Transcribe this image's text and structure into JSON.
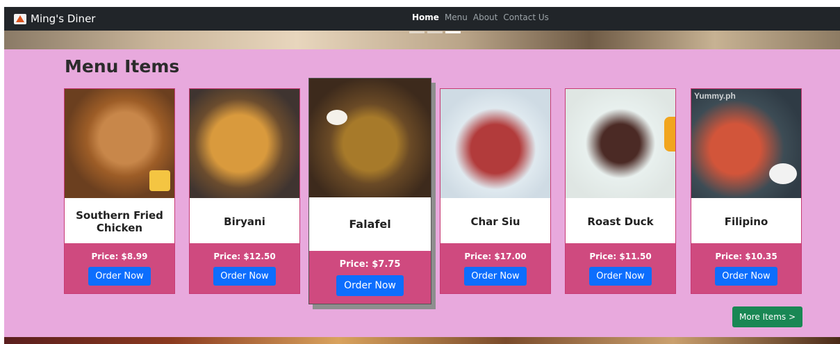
{
  "navbar": {
    "brand": "Ming's Diner",
    "links": [
      {
        "label": "Home",
        "active": true
      },
      {
        "label": "Menu",
        "active": false
      },
      {
        "label": "About",
        "active": false
      },
      {
        "label": "Contact Us",
        "active": false
      }
    ]
  },
  "carousel": {
    "slides": 3,
    "active_slide": 3
  },
  "menu": {
    "title": "Menu Items",
    "items": [
      {
        "name": "Southern Fried Chicken",
        "price": "Price: $8.99",
        "button": "Order Now"
      },
      {
        "name": "Biryani",
        "price": "Price: $12.50",
        "button": "Order Now"
      },
      {
        "name": "Falafel",
        "price": "Price: $7.75",
        "button": "Order Now"
      },
      {
        "name": "Char Siu",
        "price": "Price: $17.00",
        "button": "Order Now"
      },
      {
        "name": "Roast Duck",
        "price": "Price: $11.50",
        "button": "Order Now"
      },
      {
        "name": "Filipino",
        "price": "Price: $10.35",
        "button": "Order Now",
        "image_watermark": "Yummy.ph"
      }
    ],
    "more_button": "More Items >"
  },
  "colors": {
    "navbar": "#212529",
    "section_bg": "#e8a9dd",
    "card_footer": "#cf4a7f",
    "order_button": "#0d6efd",
    "more_button": "#198754"
  }
}
